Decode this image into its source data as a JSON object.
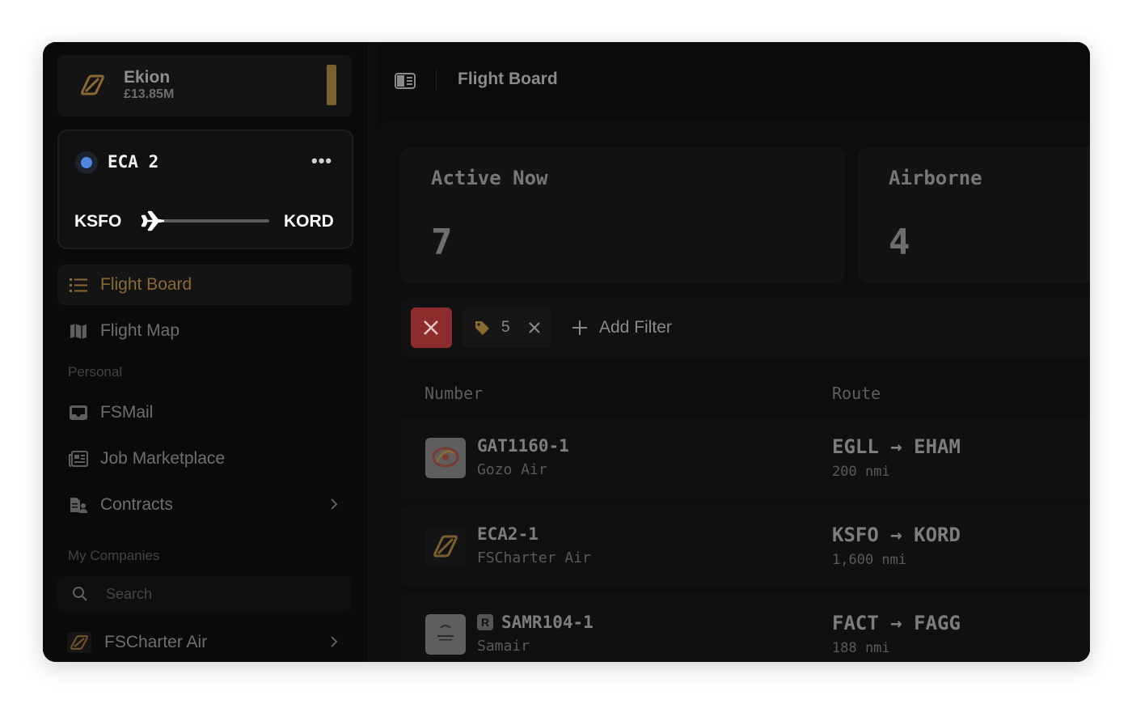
{
  "company": {
    "name": "Ekion",
    "balance": "£13.85M"
  },
  "active_flight": {
    "callsign": "ECA 2",
    "origin": "KSFO",
    "destination": "KORD",
    "progress": 0.05,
    "status_color": "#4f86e0"
  },
  "nav": {
    "flight_board": "Flight Board",
    "flight_map": "Flight Map",
    "personal_section": "Personal",
    "fsmail": "FSMail",
    "job_marketplace": "Job Marketplace",
    "contracts": "Contracts",
    "companies_section": "My Companies",
    "search_placeholder": "Search",
    "company_item": "FSCharter Air"
  },
  "header": {
    "title": "Flight Board"
  },
  "stats": [
    {
      "label": "Active Now",
      "value": "7"
    },
    {
      "label": "Airborne",
      "value": "4"
    }
  ],
  "filters": {
    "chip_value": "5",
    "add_filter_label": "Add Filter"
  },
  "table": {
    "columns": [
      "Number",
      "Route"
    ],
    "rows": [
      {
        "number": "GAT1160-1",
        "airline": "Gozo Air",
        "route": "EGLL → EHAM",
        "distance": "200 nmi",
        "badge": ""
      },
      {
        "number": "ECA2-1",
        "airline": "FSCharter Air",
        "route": "KSFO → KORD",
        "distance": "1,600 nmi",
        "badge": ""
      },
      {
        "number": "SAMR104-1",
        "airline": "Samair",
        "route": "FACT → FAGG",
        "distance": "188 nmi",
        "badge": "R"
      }
    ]
  },
  "colors": {
    "accent_gold": "#8a6a33",
    "danger": "#8c2c2c",
    "status_blue": "#4f86e0"
  }
}
